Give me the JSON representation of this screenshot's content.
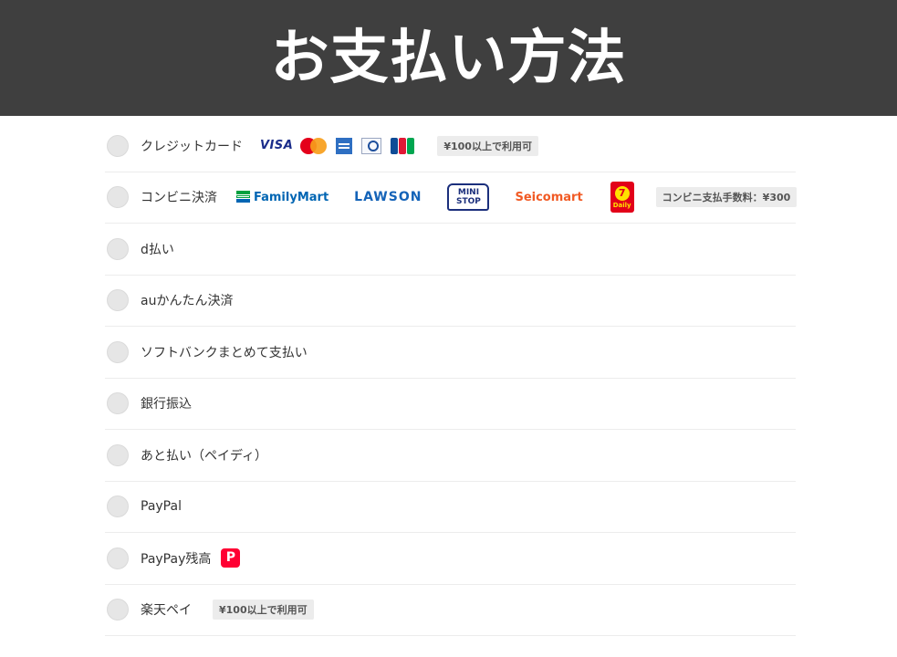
{
  "header": {
    "title": "お支払い方法"
  },
  "methods": [
    {
      "label": "クレジットカード",
      "note": "¥100以上で利用可",
      "logos": {
        "visa": "VISA"
      }
    },
    {
      "label": "コンビニ決済",
      "note": "コンビニ支払手数料：¥300",
      "logos": {
        "familymart": "FamilyMart",
        "lawson": "LAWSON",
        "ministop_line1": "MINI",
        "ministop_line2": "STOP",
        "seicomart": "Seicomart",
        "daily_mark": "7",
        "daily": "Daily"
      }
    },
    {
      "label": "d払い"
    },
    {
      "label": "auかんたん決済"
    },
    {
      "label": "ソフトバンクまとめて支払い"
    },
    {
      "label": "銀行振込"
    },
    {
      "label": "あと払い（ペイディ）"
    },
    {
      "label": "PayPal"
    },
    {
      "label": "PayPay残高",
      "logo": "P"
    },
    {
      "label": "楽天ペイ",
      "note": "¥100以上で利用可"
    }
  ],
  "colors": {
    "header_bg": "#3f3f3f",
    "radio_bg": "#e6e6e6",
    "note_bg": "#ececec",
    "paypay_red": "#ff0033"
  }
}
